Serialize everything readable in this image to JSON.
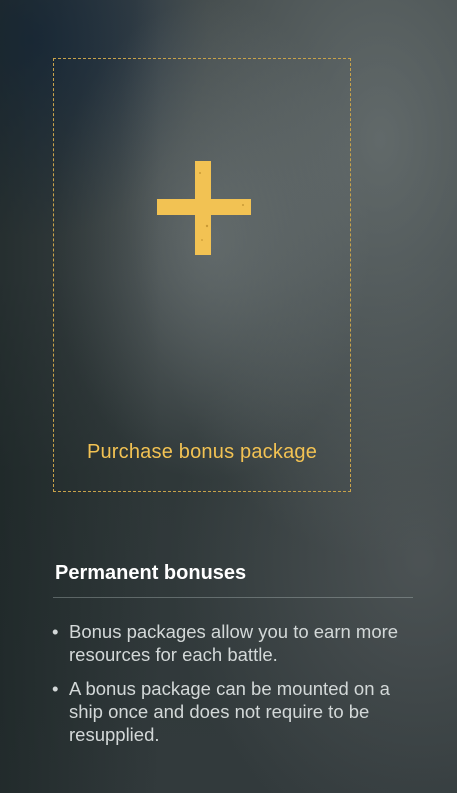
{
  "purchase_slot": {
    "label": "Purchase bonus package",
    "icon": "plus-icon",
    "accent_color": "#f2c253",
    "border_color": "#c8a24a"
  },
  "permanent_bonuses": {
    "title": "Permanent bonuses",
    "bullet_glyph": "•",
    "items": [
      "Bonus packages allow you to earn more resources for each battle.",
      "A bonus package can be mounted on a ship once and does not require to be resupplied."
    ]
  }
}
